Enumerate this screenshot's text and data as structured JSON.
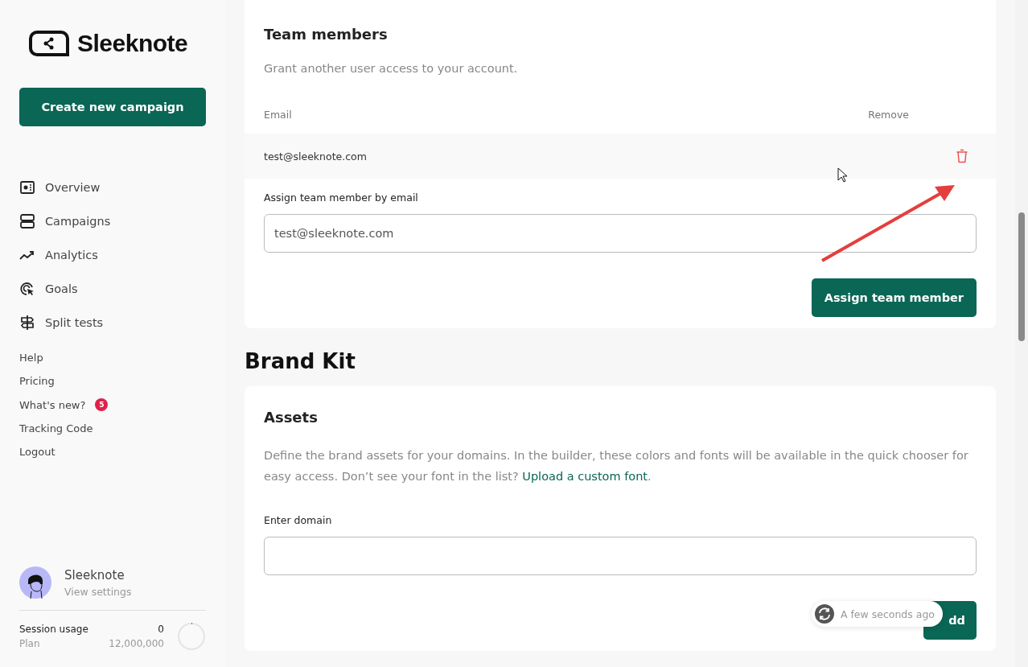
{
  "sidebar": {
    "logo": "Sleeknote",
    "create_button": "Create new campaign",
    "nav": [
      {
        "label": "Overview"
      },
      {
        "label": "Campaigns"
      },
      {
        "label": "Analytics"
      },
      {
        "label": "Goals"
      },
      {
        "label": "Split tests"
      }
    ],
    "links": [
      {
        "label": "Help"
      },
      {
        "label": "Pricing"
      },
      {
        "label": "What's new?",
        "badge": "5"
      },
      {
        "label": "Tracking Code"
      },
      {
        "label": "Logout"
      }
    ],
    "profile": {
      "name": "Sleeknote",
      "link": "View settings"
    },
    "usage": {
      "label": "Session usage",
      "value": "0",
      "plan_label": "Plan",
      "plan_value": "12,000,000",
      "level": 0.01
    }
  },
  "team": {
    "title": "Team members",
    "subtitle": "Grant another user access to your account.",
    "columns": [
      "Email",
      "Remove"
    ],
    "rows": [
      {
        "email": "test@sleeknote.com"
      }
    ],
    "assign_label": "Assign team member by email",
    "assign_value": "test@sleeknote.com",
    "assign_button": "Assign team member"
  },
  "brand_kit": {
    "heading": "Brand Kit",
    "title": "Assets",
    "description": "Define the brand assets for your domains. In the builder, these colors and fonts will be available in the quick chooser for easy access. Don’t see your font in the list? ",
    "link": "Upload a custom font",
    "link_suffix": ".",
    "domain_label": "Enter domain",
    "add_button": "dd"
  },
  "toast": {
    "text": "A few seconds ago"
  }
}
